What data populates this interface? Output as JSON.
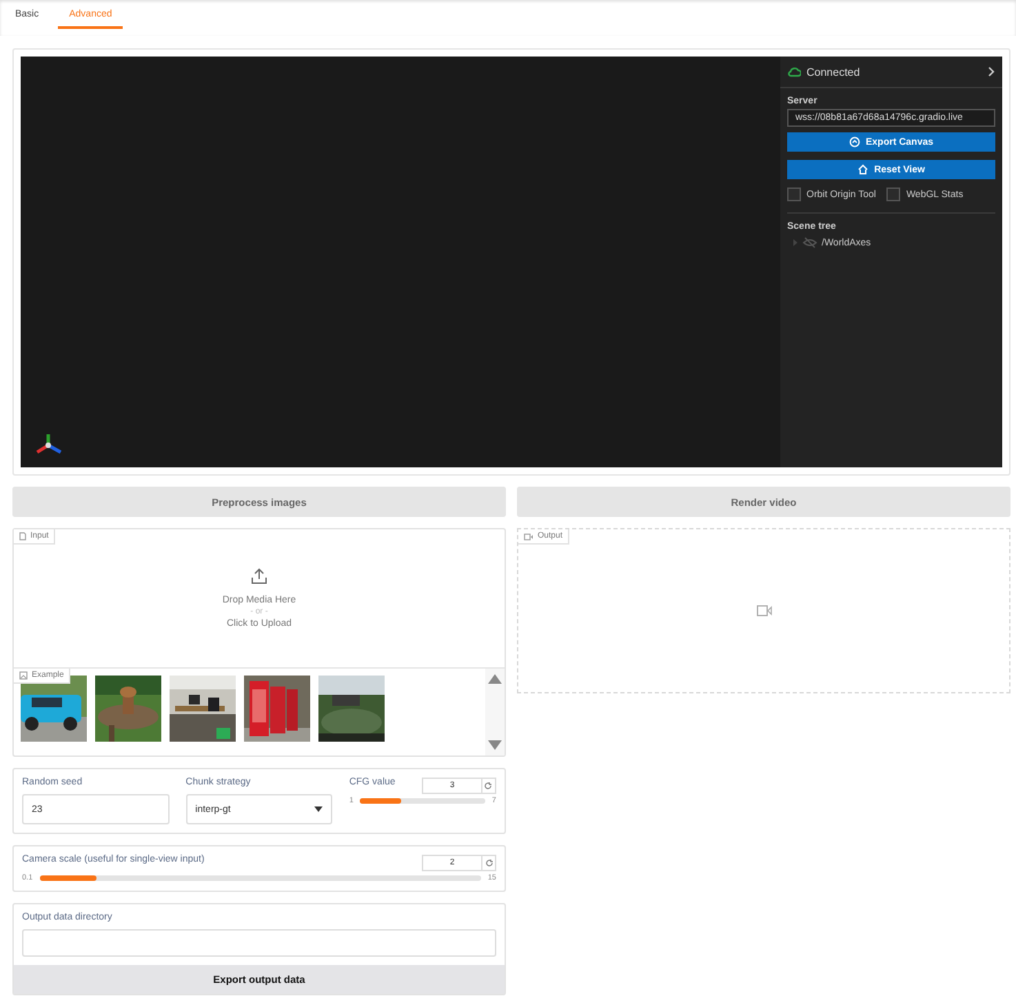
{
  "tabs": [
    {
      "label": "Basic",
      "selected": false
    },
    {
      "label": "Advanced",
      "selected": true
    }
  ],
  "viewer": {
    "status": "Connected",
    "server_label": "Server",
    "server_url": "wss://08b81a67d68a14796c.gradio.live",
    "buttons": [
      "Export Canvas",
      "Reset View"
    ],
    "options": [
      {
        "label": "Orbit Origin Tool",
        "checked": false
      },
      {
        "label": "WebGL Stats",
        "checked": false
      }
    ],
    "scene_tree_label": "Scene tree",
    "scene_tree": [
      {
        "label": "/WorldAxes",
        "visible": false
      }
    ]
  },
  "preprocess_button": "Preprocess images",
  "render_button": "Render video",
  "input": {
    "label": "Input",
    "drop_text": "Drop Media Here",
    "or_text": "- or -",
    "click_text": "Click to Upload",
    "examples_label": "Example"
  },
  "output": {
    "label": "Output"
  },
  "params": {
    "seed": {
      "label": "Random seed",
      "value": "23"
    },
    "chunk": {
      "label": "Chunk strategy",
      "value": "interp-gt"
    },
    "cfg": {
      "label": "CFG value",
      "value": "3",
      "min": "1",
      "max": "7",
      "level": 0.33
    }
  },
  "camera": {
    "label": "Camera scale (useful for single-view input)",
    "value": "2",
    "min": "0.1",
    "max": "15",
    "level": 0.13
  },
  "output_dir": {
    "label": "Output data directory",
    "button": "Export output data"
  }
}
